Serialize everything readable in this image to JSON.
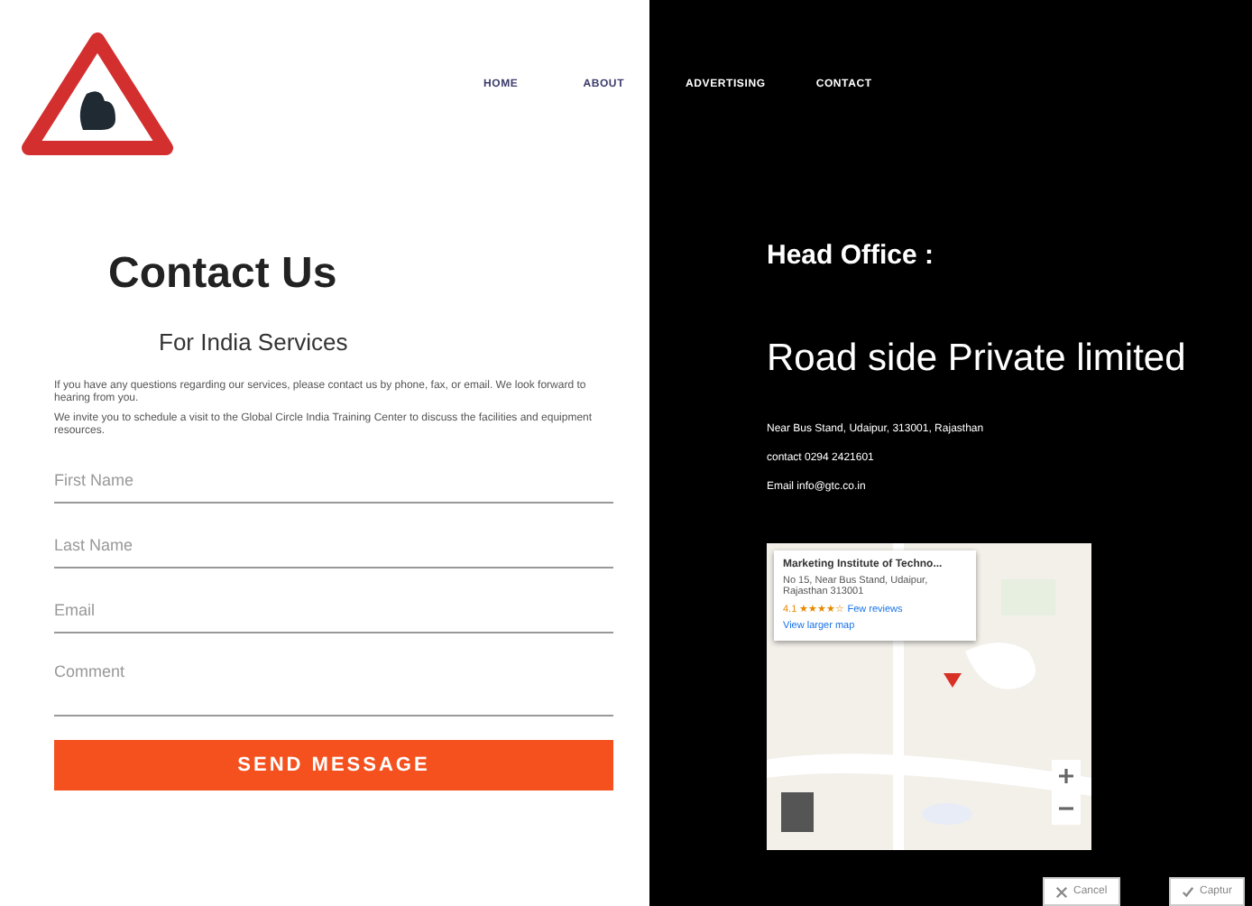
{
  "nav": [
    {
      "label": "HOME"
    },
    {
      "label": "ABOUT"
    },
    {
      "label": "ADVERTISING"
    },
    {
      "label": "CONTACT"
    }
  ],
  "contact": {
    "title": "Contact Us",
    "subtitle": "For India Services",
    "paragraphs": [
      "If you have any questions regarding our services, please contact us by phone, fax, or email. We look forward to hearing from you.",
      "We invite you to schedule a visit to the Global Circle India Training Center to discuss the facilities and equipment resources."
    ],
    "fields": [
      {
        "placeholder": "First Name",
        "kind": "input"
      },
      {
        "placeholder": "Last Name",
        "kind": "input"
      },
      {
        "placeholder": "Email",
        "kind": "input"
      },
      {
        "placeholder": "Comment",
        "kind": "textarea"
      }
    ],
    "submit": "SEND MESSAGE"
  },
  "office": {
    "heading": "Head Office :",
    "company": "Road side Private limited",
    "lines": [
      "Near Bus Stand, Udaipur, 313001, Rajasthan",
      "contact 0294 2421601",
      "Email info@gtc.co.in"
    ],
    "map": {
      "place": "Marketing Institute of Techno...",
      "address": "No 15, Near Bus Stand, Udaipur, Rajasthan 313001",
      "rating": "4.1 ★★★★☆",
      "reviews": "Few reviews",
      "link": "View larger map"
    }
  },
  "dialog_buttons": [
    {
      "label": "Cancel",
      "kind": "cancel"
    },
    {
      "label": "Captur",
      "kind": "confirm"
    }
  ]
}
